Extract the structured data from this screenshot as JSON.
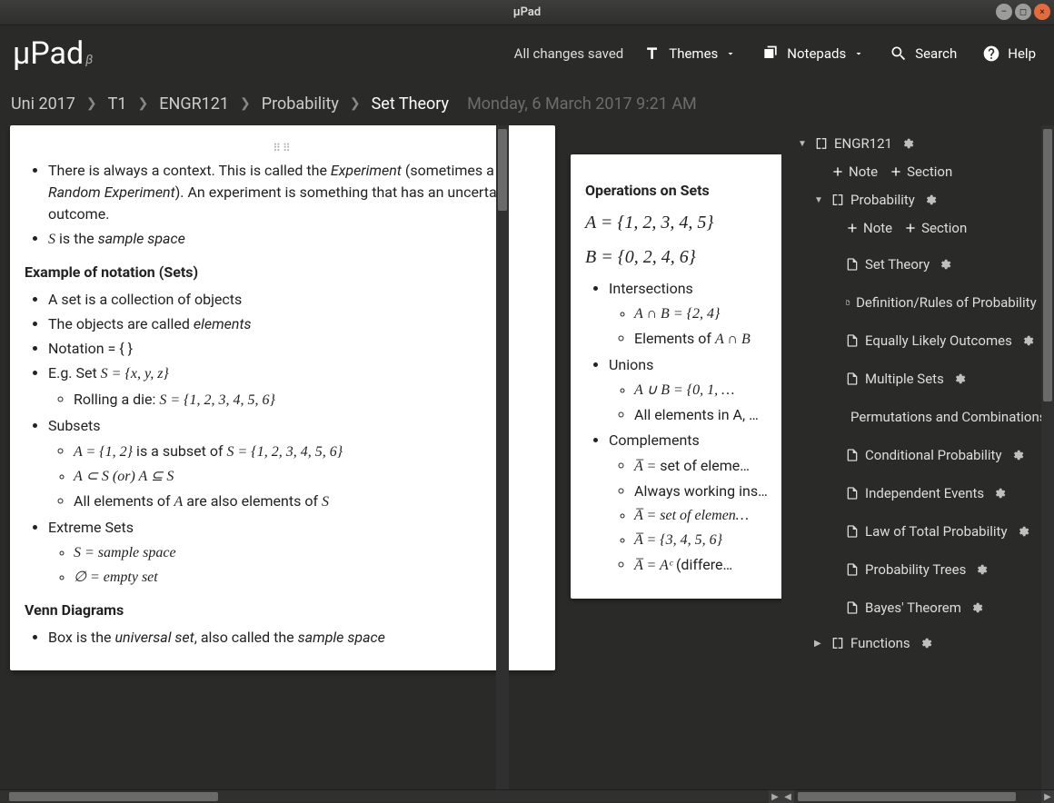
{
  "window": {
    "title": "µPad"
  },
  "logo": {
    "name": "µPad",
    "badge": "β"
  },
  "nav": {
    "saved_status": "All changes saved",
    "themes": "Themes",
    "notepads": "Notepads",
    "search": "Search",
    "help": "Help"
  },
  "breadcrumbs": {
    "items": [
      "Uni 2017",
      "T1",
      "ENGR121",
      "Probability",
      "Set Theory"
    ],
    "timestamp": "Monday, 6 March 2017 9:21 AM"
  },
  "card1": {
    "handle": "⠿",
    "line1_a": "There is always a context. This is called the ",
    "line1_em": "Experiment",
    "line1_b": " (sometimes a ",
    "line1_em2": "Random Experiment",
    "line1_c": "). An experiment is something that has an uncertain outcome.",
    "line2_a": "S",
    "line2_b": " is the ",
    "line2_em": "sample space",
    "heading1": "Example of notation (Sets)",
    "b1": "A set is a collection of objects",
    "b2_a": "The objects are called ",
    "b2_em": "elements",
    "b3": "Notation = { }",
    "b4_a": "E.g. Set ",
    "b4_m": "S = {x, y, z}",
    "b4s1_a": "Rolling a die: ",
    "b4s1_m": "S = {1, 2, 3, 4, 5, 6}",
    "b5": "Subsets",
    "b5s1_a": "A = {1, 2}",
    "b5s1_b": " is a subset of ",
    "b5s1_c": "S = {1, 2, 3, 4, 5, 6}",
    "b5s2": "A ⊂ S (or) A ⊆ S",
    "b5s3_a": "All elements of ",
    "b5s3_m1": "A",
    "b5s3_b": " are also elements of ",
    "b5s3_m2": "S",
    "b6": "Extreme Sets",
    "b6s1": "S =  sample space",
    "b6s2": "∅ =  empty set",
    "heading2": "Venn Diagrams",
    "v1_a": "Box is the ",
    "v1_em": "universal set",
    "v1_b": ", also called the ",
    "v1_em2": "sample space"
  },
  "card2": {
    "heading": "Operations on Sets",
    "mA": "A = {1, 2, 3, 4, 5}",
    "mB": "B = {0, 2, 4, 6}",
    "int": "Intersections",
    "int1": "A ∩ B = {2, 4}",
    "int2_a": "Elements of ",
    "int2_m": "A ∩ B",
    "uni": "Unions",
    "uni1": "A ∪ B = {0, 1, …",
    "uni2": "All elements in A, …",
    "comp": "Complements",
    "comp1_a": "A̅ = ",
    "comp1_b": " set of eleme…",
    "comp2": "Always working ins…",
    "comp3": "A̅ = set of elemen…",
    "comp4": "A̅ = {3, 4, 5, 6}",
    "comp5_a": "A̅ = Aᶜ",
    "comp5_b": " (differe…"
  },
  "sidebar": {
    "engr121": "ENGR121",
    "add_note": "Note",
    "add_section": "Section",
    "probability": "Probability",
    "pages": [
      "Set Theory",
      "Definition/Rules of Probability",
      "Equally Likely Outcomes",
      "Multiple Sets",
      "Permutations and Combinations",
      "Conditional Probability",
      "Independent Events",
      "Law of Total Probability",
      "Probability Trees",
      "Bayes' Theorem"
    ],
    "functions": "Functions"
  }
}
